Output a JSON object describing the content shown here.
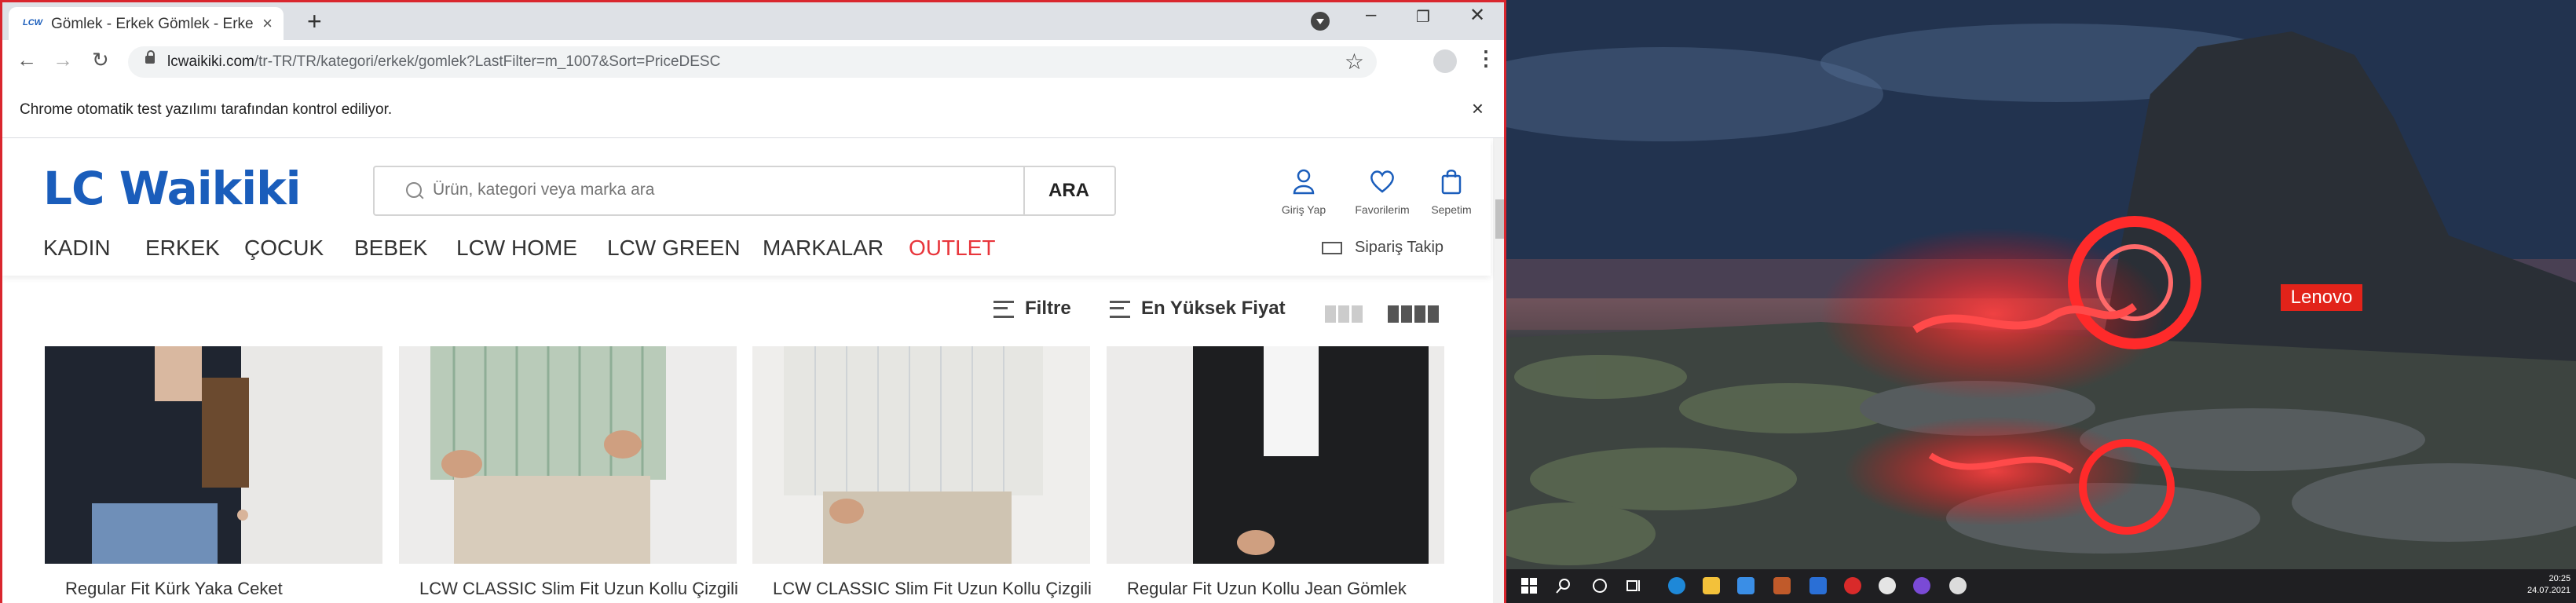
{
  "browser": {
    "tab_title": "Gömlek - Erkek Gömlek - Erkek Gö",
    "tab_favicon": "LCW",
    "url_host": "lcwaikiki.com",
    "url_path": "/tr-TR/TR/kategori/erkek/gomlek?LastFilter=m_1007&Sort=PriceDESC",
    "infobar_text": "Chrome otomatik test yazılımı tarafından kontrol ediliyor.",
    "new_tab": "+",
    "icons": {
      "back": "back-arrow-icon",
      "forward": "forward-arrow-icon",
      "reload": "reload-icon",
      "star": "bookmark-star-icon"
    }
  },
  "site": {
    "logo": "LC Waikiki",
    "search_placeholder": "Ürün, kategori veya marka ara",
    "search_button": "ARA",
    "header_icons": [
      {
        "label": "Giriş Yap",
        "icon": "user-icon"
      },
      {
        "label": "Favorilerim",
        "icon": "heart-icon"
      },
      {
        "label": "Sepetim",
        "icon": "bag-icon"
      }
    ],
    "menu": [
      "KADIN",
      "ERKEK",
      "ÇOCUK",
      "BEBEK",
      "LCW HOME",
      "LCW GREEN",
      "MARKALAR",
      "OUTLET"
    ],
    "order_tracking": "Sipariş Takip",
    "filter_label": "Filtre",
    "sort_label": "En Yüksek Fiyat",
    "products": [
      {
        "name": "Regular Fit Kürk Yaka Ceket"
      },
      {
        "name": "LCW CLASSIC Slim Fit Uzun Kollu Çizgili"
      },
      {
        "name": "LCW CLASSIC Slim Fit Uzun Kollu Çizgili"
      },
      {
        "name": "Regular Fit Uzun Kollu Jean Gömlek"
      }
    ]
  },
  "desktop": {
    "brand_badge": "Lenovo",
    "clock_time": "20:25",
    "clock_date": "24.07.2021"
  },
  "colors": {
    "brand_blue": "#1a5dbb",
    "outlet_red": "#e8353b",
    "window_border": "#d9262e"
  }
}
